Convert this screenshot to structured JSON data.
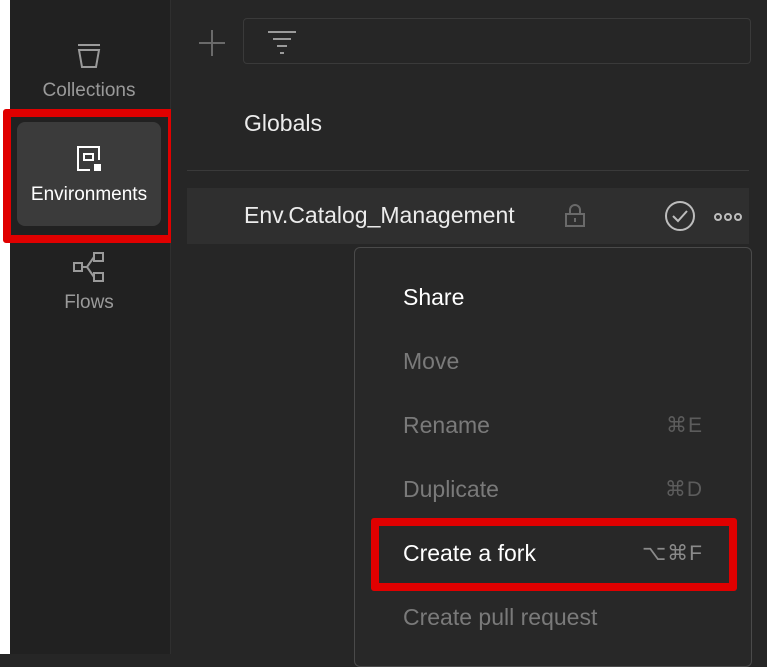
{
  "sidebar": {
    "items": [
      {
        "label": "Collections",
        "icon": "trash-bin-icon",
        "active": false
      },
      {
        "label": "Environments",
        "icon": "environment-icon",
        "active": true
      },
      {
        "label": "Flows",
        "icon": "flows-icon",
        "active": false
      }
    ]
  },
  "toolbar": {
    "add_icon": "plus-icon",
    "filter_icon": "filter-icon"
  },
  "list": {
    "globals_label": "Globals",
    "environment": {
      "name": "Env.Catalog_Management",
      "locked_icon": "lock-icon",
      "active_icon": "check-circle-icon",
      "more_icon": "more-options-icon"
    }
  },
  "context_menu": {
    "items": [
      {
        "label": "Share",
        "shortcut": "",
        "enabled": true
      },
      {
        "label": "Move",
        "shortcut": "",
        "enabled": false
      },
      {
        "label": "Rename",
        "shortcut": "⌘E",
        "enabled": false
      },
      {
        "label": "Duplicate",
        "shortcut": "⌘D",
        "enabled": false
      },
      {
        "label": "Create a fork",
        "shortcut": "⌥⌘F",
        "enabled": true
      },
      {
        "label": "Create pull request",
        "shortcut": "",
        "enabled": false
      }
    ]
  },
  "colors": {
    "highlight": "#e00000",
    "background": "#262626",
    "sidebar": "#212121",
    "active_item": "#3b3b3b"
  }
}
